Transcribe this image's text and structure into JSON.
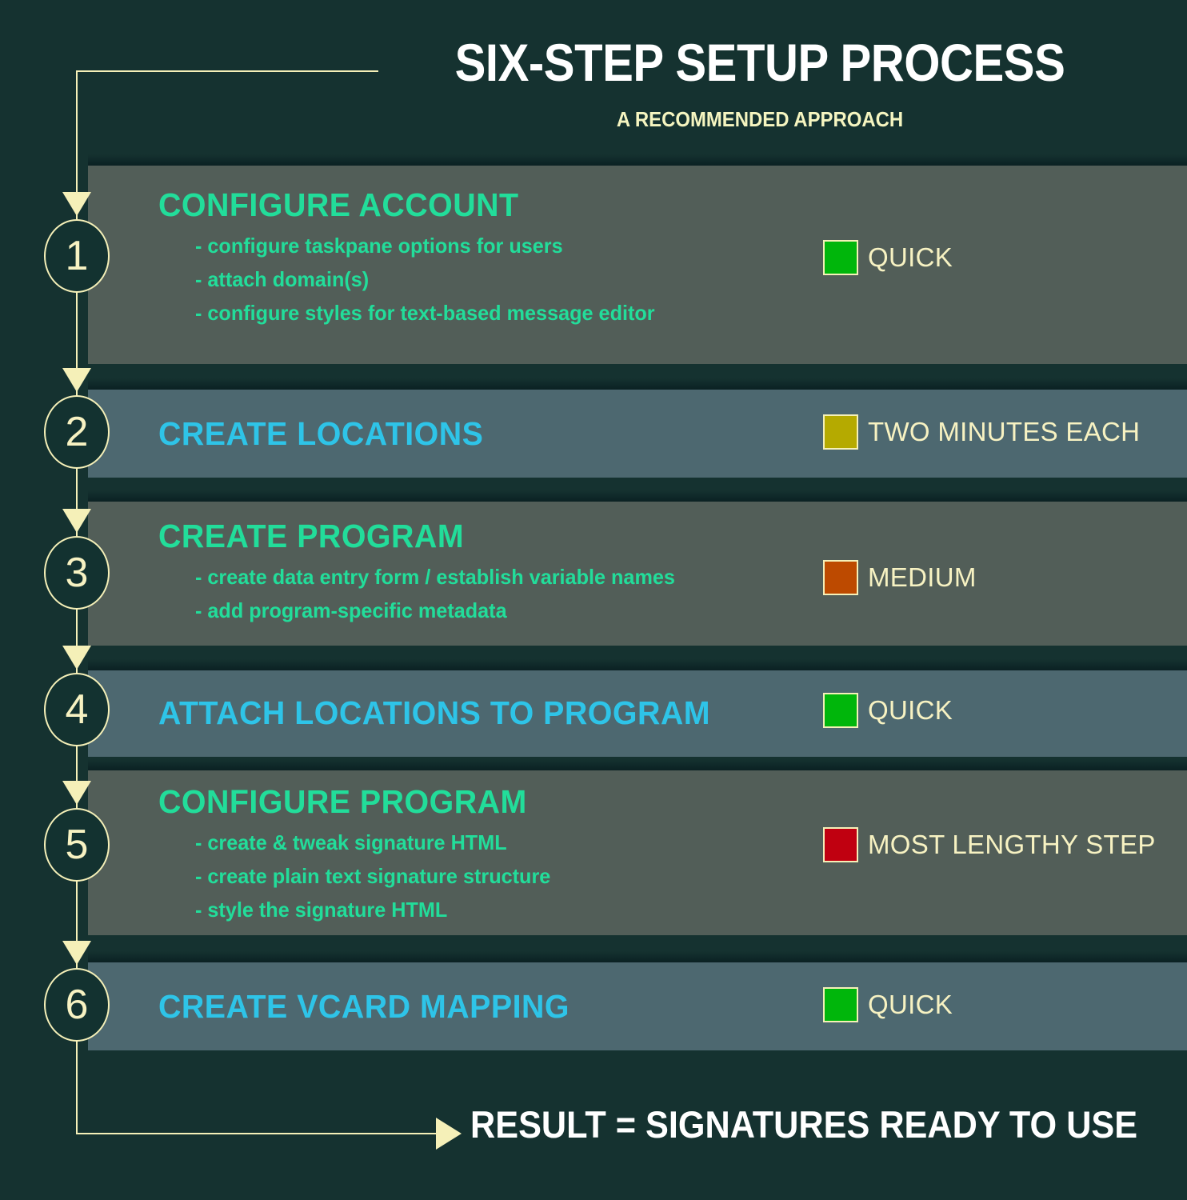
{
  "header": {
    "title": "SIX-STEP SETUP PROCESS",
    "subtitle": "A RECOMMENDED APPROACH",
    "title_color": "#ffffff",
    "subtitle_color": "#f5f5c0"
  },
  "theme": {
    "background": "#153230",
    "connector_color": "#f5f0b8",
    "row_band_a": "#525e58",
    "row_band_b": "#4d6870",
    "heading_green": "#22dd9a",
    "heading_cyan": "#2ec4e8",
    "label_text": "#f7f2c2"
  },
  "steps": [
    {
      "number": "1",
      "heading": "CONFIGURE ACCOUNT",
      "heading_color": "#22dd9a",
      "band": "greenish",
      "bullets": [
        "- configure taskpane options for users",
        "- attach domain(s)",
        "- configure styles for text-based message editor"
      ],
      "effort": {
        "label": "QUICK",
        "color": "#00b60b"
      }
    },
    {
      "number": "2",
      "heading": "CREATE LOCATIONS",
      "heading_color": "#2ec4e8",
      "band": "blueish",
      "bullets": [],
      "effort": {
        "label": "TWO MINUTES EACH",
        "color": "#b5aa00"
      }
    },
    {
      "number": "3",
      "heading": "CREATE PROGRAM",
      "heading_color": "#22dd9a",
      "band": "greenish",
      "bullets": [
        "- create data entry form / establish variable names",
        "- add program-specific metadata"
      ],
      "effort": {
        "label": "MEDIUM",
        "color": "#bd4a00"
      }
    },
    {
      "number": "4",
      "heading": "ATTACH LOCATIONS TO PROGRAM",
      "heading_color": "#2ec4e8",
      "band": "blueish",
      "bullets": [],
      "effort": {
        "label": "QUICK",
        "color": "#00b60b"
      }
    },
    {
      "number": "5",
      "heading": "CONFIGURE PROGRAM",
      "heading_color": "#22dd9a",
      "band": "greenish",
      "bullets": [
        "- create & tweak signature HTML",
        "- create plain text signature structure",
        "- style the signature HTML"
      ],
      "effort": {
        "label": "MOST LENGTHY STEP",
        "color": "#c00010"
      }
    },
    {
      "number": "6",
      "heading": "CREATE VCARD MAPPING",
      "heading_color": "#2ec4e8",
      "band": "blueish",
      "bullets": [],
      "effort": {
        "label": "QUICK",
        "color": "#00b60b"
      }
    }
  ],
  "footer": {
    "result_text": "RESULT = SIGNATURES READY TO USE"
  }
}
